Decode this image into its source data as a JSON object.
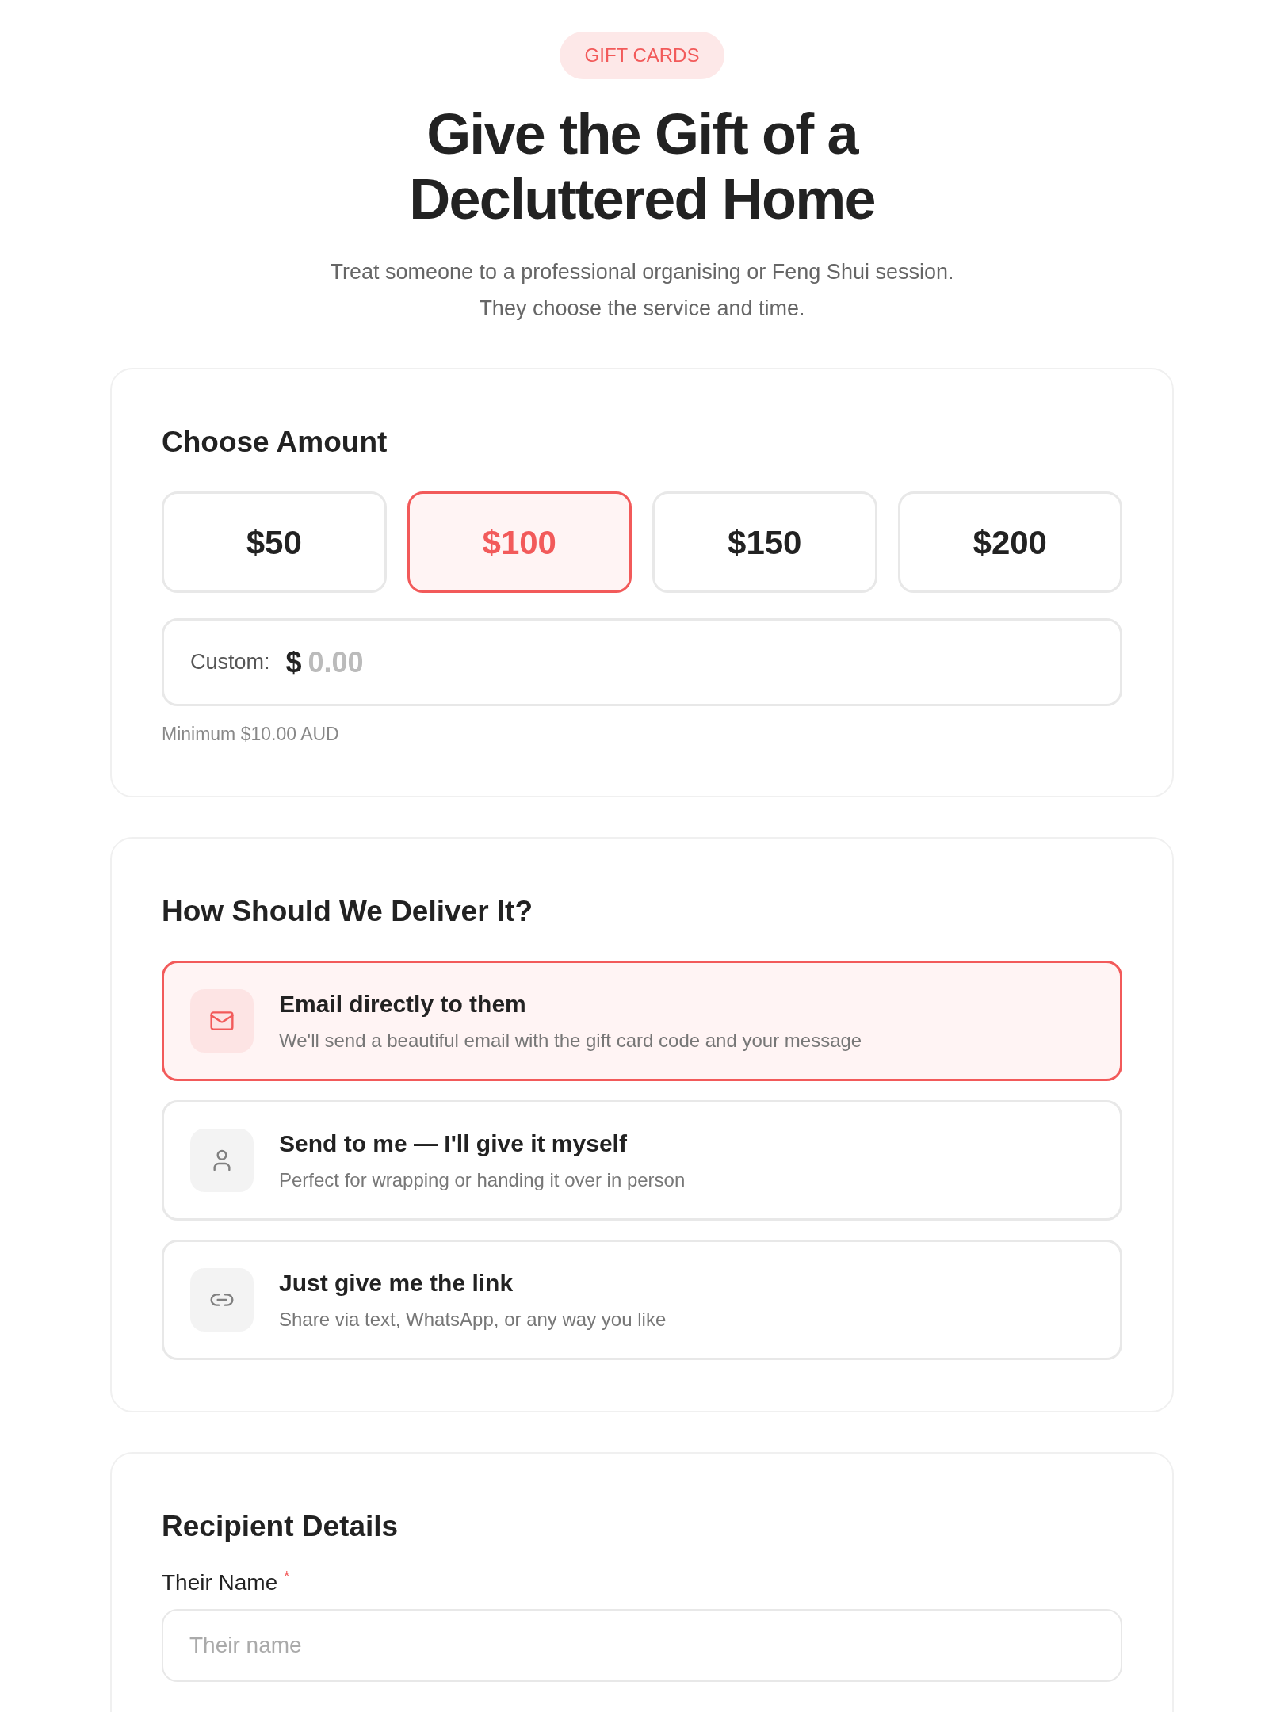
{
  "badge": "GIFT CARDS",
  "title": [
    "Give the Gift of a",
    "Decluttered Home"
  ],
  "subtitle": [
    "Treat someone to a professional organising or Feng Shui session.",
    "They choose the service and time."
  ],
  "amount": {
    "heading": "Choose Amount",
    "options": [
      {
        "label": "$50",
        "selected": false
      },
      {
        "label": "$100",
        "selected": true
      },
      {
        "label": "$150",
        "selected": false
      },
      {
        "label": "$200",
        "selected": false
      }
    ],
    "custom": {
      "label": "Custom:",
      "currency": "$",
      "placeholder": "0.00"
    },
    "hint": "Minimum $10.00 AUD"
  },
  "delivery": {
    "heading": "How Should We Deliver It?",
    "options": [
      {
        "kind": "email",
        "title": "Email directly to them",
        "description": "We'll send a beautiful email with the gift card code and your message",
        "selected": true
      },
      {
        "kind": "self",
        "title": "Send to me — I'll give it myself",
        "description": "Perfect for wrapping or handing it over in person",
        "selected": false
      },
      {
        "kind": "link",
        "title": "Just give me the link",
        "description": "Share via text, WhatsApp, or any way you like",
        "selected": false
      }
    ]
  },
  "recipient": {
    "heading": "Recipient Details",
    "fields": [
      {
        "label": "Their Name",
        "required_mark": "*",
        "placeholder": "Their name"
      }
    ]
  }
}
